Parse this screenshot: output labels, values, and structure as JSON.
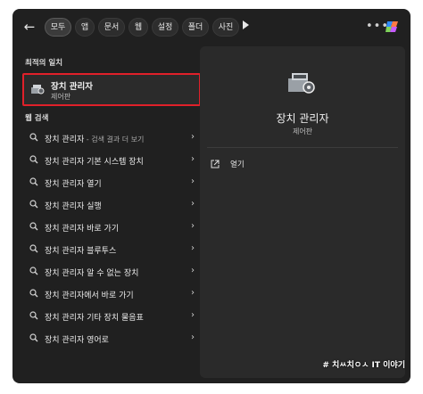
{
  "tabs": [
    "모두",
    "앱",
    "문서",
    "웹",
    "설정",
    "폴더",
    "사진"
  ],
  "left": {
    "best_match_heading": "최적의 일치",
    "best_match": {
      "title": "장치 관리자",
      "subtitle": "제어판"
    },
    "web_heading": "웹 검색",
    "web_results": [
      {
        "label": "장치 관리자",
        "hint": " - 검색 결과 더 보기"
      },
      {
        "label": "장치 관리자 기본 시스템 장치",
        "hint": ""
      },
      {
        "label": "장치 관리자 열기",
        "hint": ""
      },
      {
        "label": "장치 관리자 실행",
        "hint": ""
      },
      {
        "label": "장치 관리자 바로 가기",
        "hint": ""
      },
      {
        "label": "장치 관리자 블루투스",
        "hint": ""
      },
      {
        "label": "장치 관리자 알 수 없는 장치",
        "hint": ""
      },
      {
        "label": "장치 관리자에서 바로 가기",
        "hint": ""
      },
      {
        "label": "장치 관리자 기타 장치 물음표",
        "hint": ""
      },
      {
        "label": "장치 관리자 영어로",
        "hint": ""
      }
    ]
  },
  "right": {
    "title": "장치 관리자",
    "subtitle": "제어판",
    "open_label": "열기"
  },
  "watermark": "# 치ㅆ치ㅇㅅ IT 이야기",
  "colors": {
    "highlight_border": "#e0202a",
    "background": "#202020",
    "panel": "#2a2a2a"
  },
  "icons": {
    "back": "arrow-left-icon",
    "more": "more-dots-icon",
    "copilot": "copilot-icon",
    "search": "magnifier-icon",
    "chevron": "chevron-right-icon",
    "open": "open-external-icon",
    "app": "device-manager-icon"
  }
}
